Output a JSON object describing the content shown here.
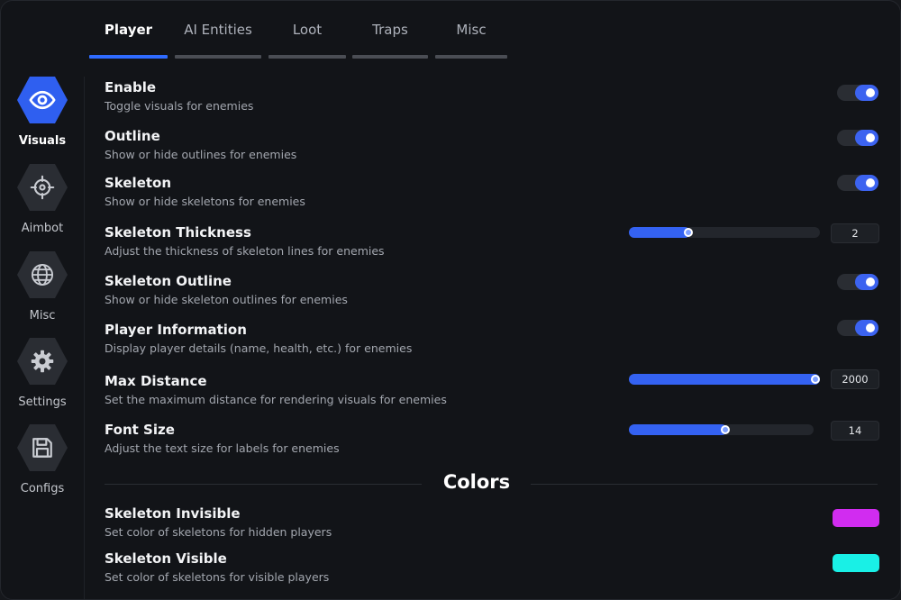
{
  "tabs": [
    {
      "label": "Player",
      "active": true
    },
    {
      "label": "AI Entities",
      "active": false
    },
    {
      "label": "Loot",
      "active": false
    },
    {
      "label": "Traps",
      "active": false
    },
    {
      "label": "Misc",
      "active": false
    }
  ],
  "sidebar": {
    "items": [
      {
        "label": "Visuals",
        "icon": "eye-icon",
        "active": true
      },
      {
        "label": "Aimbot",
        "icon": "crosshair-icon",
        "active": false
      },
      {
        "label": "Misc",
        "icon": "globe-icon",
        "active": false
      },
      {
        "label": "Settings",
        "icon": "gear-icon",
        "active": false
      },
      {
        "label": "Configs",
        "icon": "floppy-disk-icon",
        "active": false
      }
    ]
  },
  "settings": {
    "enable": {
      "title": "Enable",
      "desc": "Toggle visuals for enemies",
      "on": true
    },
    "outline": {
      "title": "Outline",
      "desc": "Show or hide outlines for enemies",
      "on": true
    },
    "skeleton": {
      "title": "Skeleton",
      "desc": "Show or hide skeletons for enemies",
      "on": true
    },
    "skeleton_thickness": {
      "title": "Skeleton Thickness",
      "desc": "Adjust the thickness of skeleton lines for enemies",
      "value": "2",
      "fill_fraction": 0.32
    },
    "skeleton_outline": {
      "title": "Skeleton Outline",
      "desc": "Show or hide skeleton outlines for enemies",
      "on": true
    },
    "player_information": {
      "title": "Player Information",
      "desc": "Display player details (name, health, etc.) for enemies",
      "on": true
    },
    "max_distance": {
      "title": "Max Distance",
      "desc": "Set the maximum distance for rendering visuals for enemies",
      "value": "2000",
      "fill_fraction": 1.0
    },
    "font_size": {
      "title": "Font Size",
      "desc": "Adjust the text size for labels for enemies",
      "value": "14",
      "fill_fraction": 0.53
    }
  },
  "colors_section": {
    "title": "Colors",
    "skeleton_invisible": {
      "title": "Skeleton Invisible",
      "desc": "Set color of skeletons for hidden players",
      "color": "#d12cf0"
    },
    "skeleton_visible": {
      "title": "Skeleton Visible",
      "desc": "Set color of skeletons for visible players",
      "color": "#19f0e6"
    }
  },
  "theme": {
    "accent": "#2f6bff",
    "background": "#121418"
  }
}
